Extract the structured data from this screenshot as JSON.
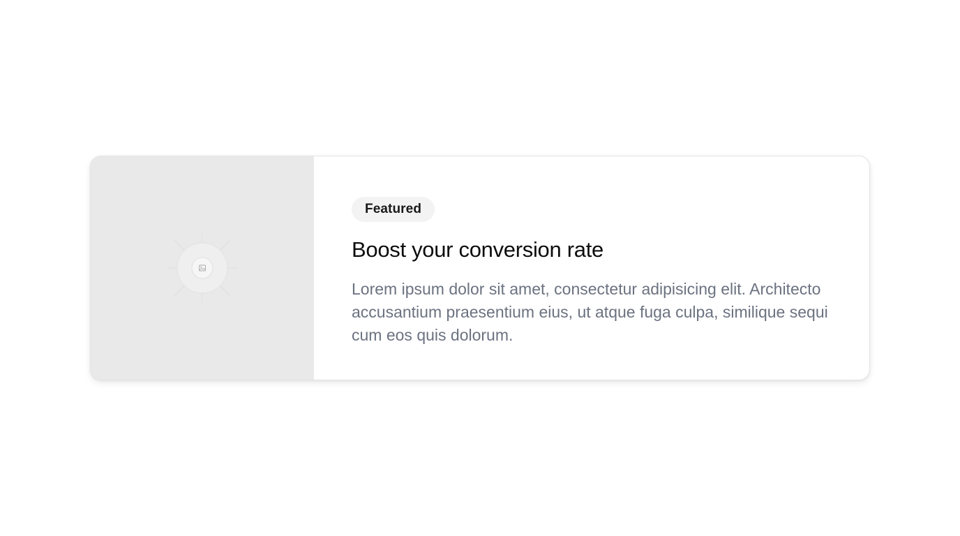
{
  "card": {
    "badge": "Featured",
    "title": "Boost your conversion rate",
    "description": "Lorem ipsum dolor sit amet, consectetur adipisicing elit. Architecto accusantium praesentium eius, ut atque fuga culpa, similique sequi cum eos quis dolorum.",
    "image_placeholder_icon": "image-icon"
  },
  "colors": {
    "page_background": "#ffffff",
    "media_background": "#e9e9e9",
    "badge_background": "#f3f3f3",
    "title_text": "#0d0d0d",
    "description_text": "#6b7280"
  }
}
